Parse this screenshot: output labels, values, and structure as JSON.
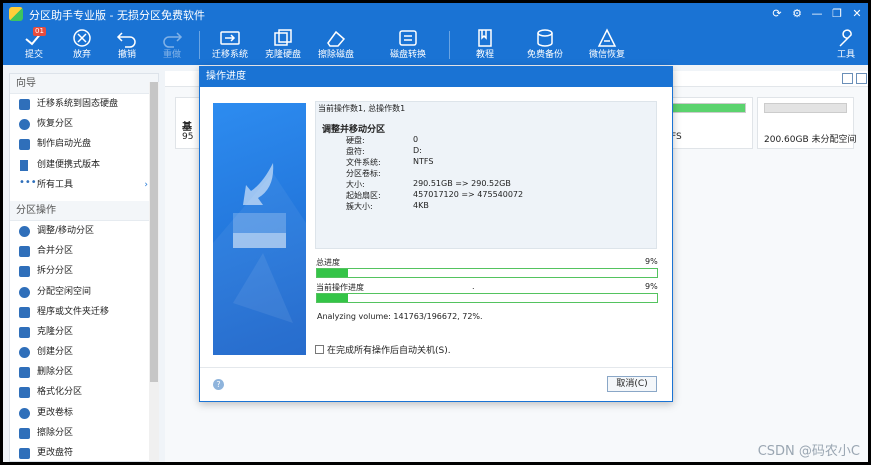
{
  "window": {
    "title": "分区助手专业版 - 无损分区免费软件",
    "controls": [
      "refresh-icon",
      "settings-icon",
      "minimize-icon",
      "restore-icon",
      "close-icon"
    ]
  },
  "toolbar": {
    "commit": {
      "label": "提交",
      "badge": "01"
    },
    "discard": "放弃",
    "undo": "撤销",
    "redo": "重做",
    "migrate": "迁移系统",
    "clone": "克隆硬盘",
    "wipe": "擦除磁盘",
    "convert": "磁盘转换",
    "tutorial": "教程",
    "backup": "免费备份",
    "wechat": "微信恢复",
    "tools": "工具"
  },
  "sidebar": {
    "guide_title": "向导",
    "guide_items": [
      {
        "label": "迁移系统到固态硬盘",
        "icon": "migrate-icon"
      },
      {
        "label": "恢复分区",
        "icon": "restore-partition-icon"
      },
      {
        "label": "制作启动光盘",
        "icon": "boot-disc-icon"
      },
      {
        "label": "创建便携式版本",
        "icon": "portable-icon"
      },
      {
        "label": "所有工具",
        "icon": "more-icon"
      }
    ],
    "ops_title": "分区操作",
    "ops_items": [
      {
        "label": "调整/移动分区",
        "icon": "resize-icon"
      },
      {
        "label": "合并分区",
        "icon": "merge-icon"
      },
      {
        "label": "拆分分区",
        "icon": "split-icon"
      },
      {
        "label": "分配空闲空间",
        "icon": "allocate-icon"
      },
      {
        "label": "程序或文件夹迁移",
        "icon": "app-move-icon"
      },
      {
        "label": "克隆分区",
        "icon": "clone-icon"
      },
      {
        "label": "创建分区",
        "icon": "create-icon"
      },
      {
        "label": "删除分区",
        "icon": "delete-icon"
      },
      {
        "label": "格式化分区",
        "icon": "format-icon"
      },
      {
        "label": "更改卷标",
        "icon": "label-icon"
      },
      {
        "label": "擦除分区",
        "icon": "wipe-icon"
      },
      {
        "label": "更改盘符",
        "icon": "letter-icon"
      }
    ]
  },
  "main": {
    "disk_left_label": "基",
    "disk_left_size": "95",
    "disk_mid_fs": "FS",
    "disk_right_label": "200.60GB 未分配空间",
    "disk_mid_fill": 1.0,
    "disk_right_fill": 0.0
  },
  "dialog": {
    "title": "操作进度",
    "current_op": "当前操作数1, 总操作数1",
    "op_name": "调整并移动分区",
    "fields": [
      {
        "k": "硬盘:",
        "v": "0"
      },
      {
        "k": "盘符:",
        "v": "D:"
      },
      {
        "k": "文件系统:",
        "v": "NTFS"
      },
      {
        "k": "分区卷标:",
        "v": ""
      },
      {
        "k": "大小:",
        "v": "290.51GB => 290.52GB"
      },
      {
        "k": "起始扇区:",
        "v": "457017120 => 475540072"
      },
      {
        "k": "簇大小:",
        "v": "4KB"
      }
    ],
    "total_label": "总进度",
    "total_pct": "9%",
    "total_value": 0.09,
    "current_label": "当前操作进度",
    "current_dot": ".",
    "current_pct": "9%",
    "current_value": 0.09,
    "analyzing": "Analyzing volume: 141763/196672, 72%.",
    "autoshutdown": "在完成所有操作后自动关机(S).",
    "cancel": "取消(C)"
  },
  "watermark": "CSDN @码农小C"
}
